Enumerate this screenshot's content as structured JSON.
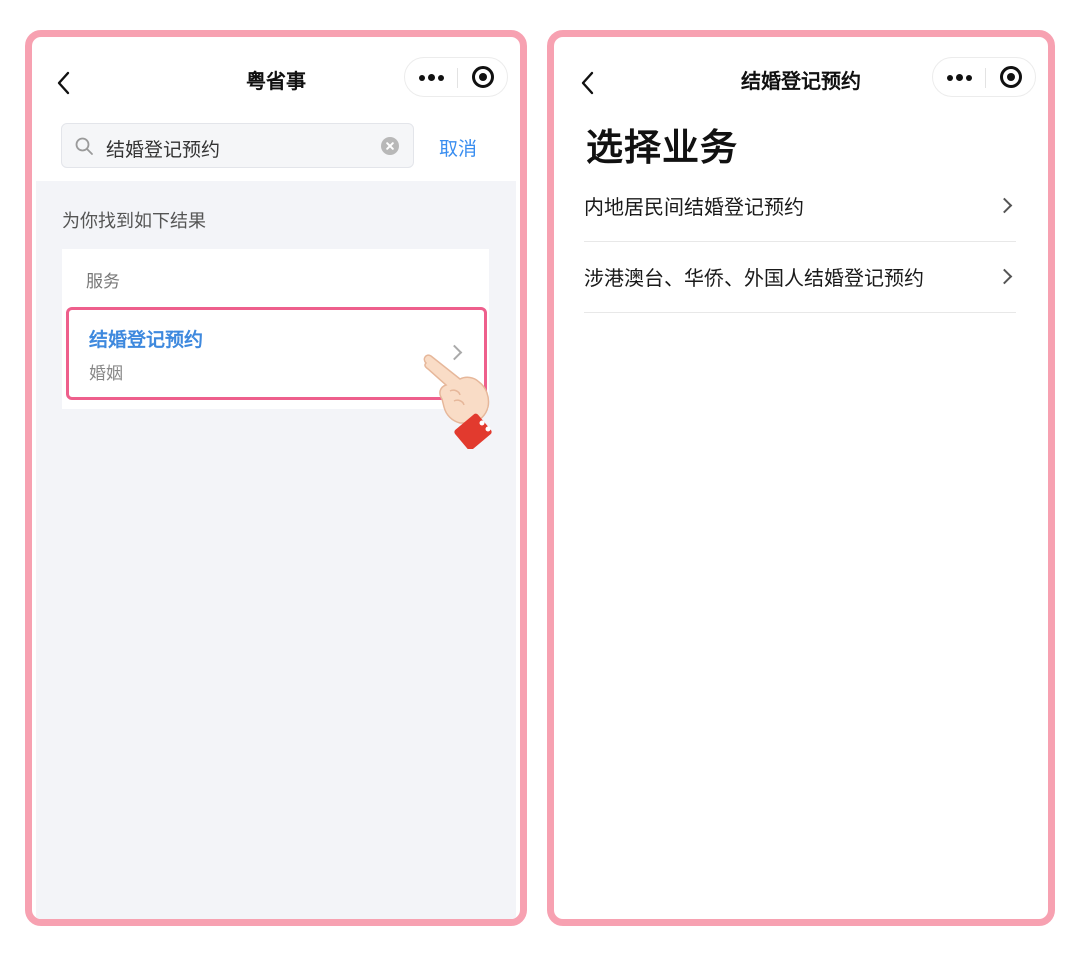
{
  "left_screen": {
    "nav_title": "粤省事",
    "search": {
      "value": "结婚登记预约",
      "cancel_label": "取消"
    },
    "results_caption": "为你找到如下结果",
    "section_label": "服务",
    "result": {
      "title": "结婚登记预约",
      "category": "婚姻"
    }
  },
  "right_screen": {
    "nav_title": "结婚登记预约",
    "heading": "选择业务",
    "items": [
      {
        "label": "内地居民间结婚登记预约"
      },
      {
        "label": "涉港澳台、华侨、外国人结婚登记预约"
      }
    ]
  },
  "colors": {
    "frame_border": "#f7a1b1",
    "highlight_border": "#ee5f8c",
    "link_blue": "#3a8ef0",
    "result_title_blue": "#3e89de",
    "page_background_gray": "#f3f4f8"
  },
  "icons": [
    "back-arrow-icon",
    "more-dots-icon",
    "target-icon",
    "search-icon",
    "clear-icon",
    "chevron-right-icon",
    "pointing-hand-icon"
  ]
}
